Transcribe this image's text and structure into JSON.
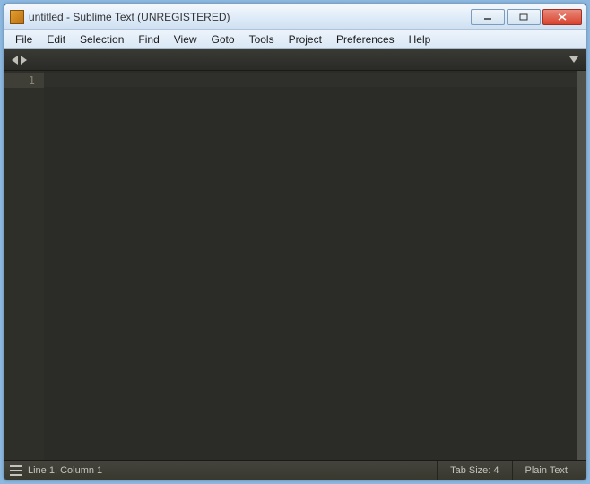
{
  "titlebar": {
    "title": "untitled - Sublime Text (UNREGISTERED)"
  },
  "menubar": {
    "items": [
      "File",
      "Edit",
      "Selection",
      "Find",
      "View",
      "Goto",
      "Tools",
      "Project",
      "Preferences",
      "Help"
    ]
  },
  "editor": {
    "line_numbers": [
      "1"
    ]
  },
  "statusbar": {
    "position": "Line 1, Column 1",
    "tab_size": "Tab Size: 4",
    "syntax": "Plain Text"
  }
}
